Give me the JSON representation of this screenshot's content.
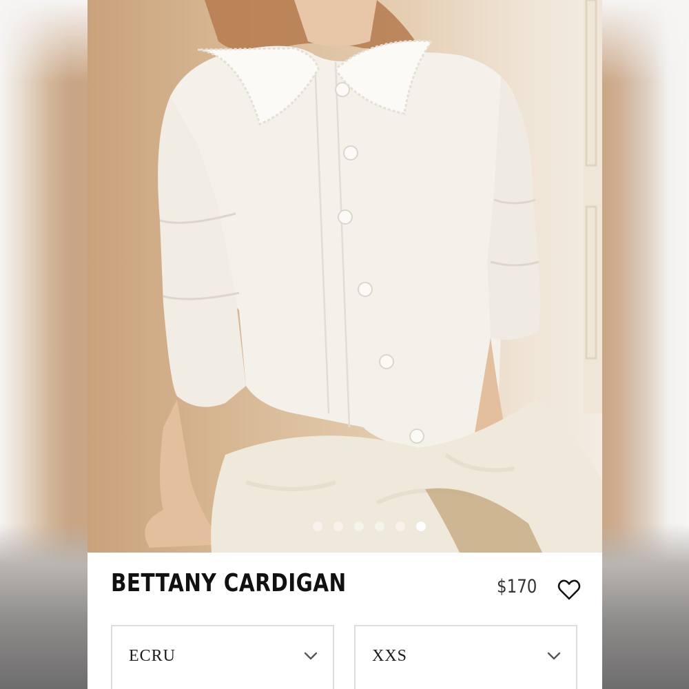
{
  "product": {
    "name": "BETTANY CARDIGAN",
    "price": "$170",
    "image_alt": "Model wearing an ecru knit cardigan with lace collar",
    "gallery": {
      "count": 6,
      "active_index": 5
    }
  },
  "options": {
    "color": {
      "selected": "ECRU",
      "icon": "chevron-down-icon"
    },
    "size": {
      "selected": "XXS",
      "icon": "chevron-down-icon"
    }
  },
  "icons": {
    "wishlist": "heart-icon"
  },
  "colors": {
    "text": "#111111",
    "price": "#333333",
    "border": "#dcdcdc",
    "garment": "#f2efe8"
  }
}
